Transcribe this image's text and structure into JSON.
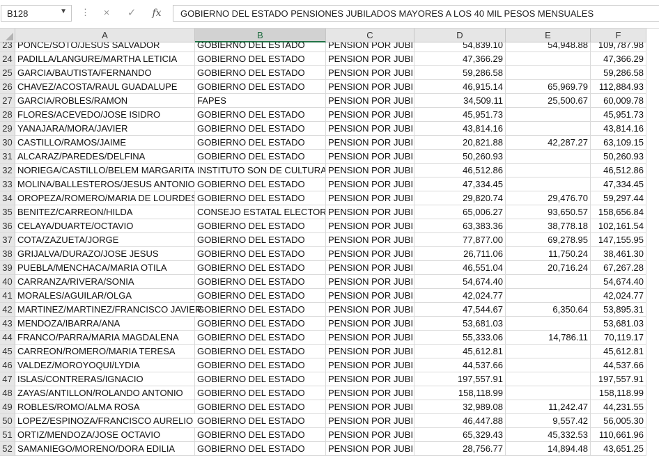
{
  "formula_bar": {
    "name_box": "B128",
    "cancel_icon": "×",
    "enter_icon": "✓",
    "fx_label": "fx",
    "formula": "GOBIERNO DEL ESTADO PENSIONES JUBILADOS MAYORES A LOS 40 MIL PESOS MENSUALES"
  },
  "columns": [
    "A",
    "B",
    "C",
    "D",
    "E",
    "F"
  ],
  "selected_column": "B",
  "rows": [
    {
      "n": "23",
      "a": "PONCE/SOTO/JESUS SALVADOR",
      "b": "GOBIERNO DEL ESTADO",
      "c": "PENSION POR JUBILACION",
      "d": "54,839.10",
      "e": "54,948.88",
      "f": "109,787.98"
    },
    {
      "n": "24",
      "a": "PADILLA/LANGURE/MARTHA LETICIA",
      "b": "GOBIERNO DEL ESTADO",
      "c": "PENSION POR JUBILACION",
      "d": "47,366.29",
      "e": "",
      "f": "47,366.29"
    },
    {
      "n": "25",
      "a": "GARCIA/BAUTISTA/FERNANDO",
      "b": "GOBIERNO DEL ESTADO",
      "c": "PENSION POR JUBILACION",
      "d": "59,286.58",
      "e": "",
      "f": "59,286.58"
    },
    {
      "n": "26",
      "a": "CHAVEZ/ACOSTA/RAUL GUADALUPE",
      "b": "GOBIERNO DEL ESTADO",
      "c": "PENSION POR JUBILACION",
      "d": "46,915.14",
      "e": "65,969.79",
      "f": "112,884.93"
    },
    {
      "n": "27",
      "a": "GARCIA/ROBLES/RAMON",
      "b": "FAPES",
      "c": "PENSION POR JUBILACION",
      "d": "34,509.11",
      "e": "25,500.67",
      "f": "60,009.78"
    },
    {
      "n": "28",
      "a": "FLORES/ACEVEDO/JOSE ISIDRO",
      "b": "GOBIERNO DEL ESTADO",
      "c": "PENSION POR JUBILACION",
      "d": "45,951.73",
      "e": "",
      "f": "45,951.73"
    },
    {
      "n": "29",
      "a": "YANAJARA/MORA/JAVIER",
      "b": "GOBIERNO DEL ESTADO",
      "c": "PENSION POR JUBILACION",
      "d": "43,814.16",
      "e": "",
      "f": "43,814.16"
    },
    {
      "n": "30",
      "a": "CASTILLO/RAMOS/JAIME",
      "b": "GOBIERNO DEL ESTADO",
      "c": "PENSION POR JUBILACION",
      "d": "20,821.88",
      "e": "42,287.27",
      "f": "63,109.15"
    },
    {
      "n": "31",
      "a": "ALCARAZ/PAREDES/DELFINA",
      "b": "GOBIERNO DEL ESTADO",
      "c": "PENSION POR JUBILACION",
      "d": "50,260.93",
      "e": "",
      "f": "50,260.93"
    },
    {
      "n": "32",
      "a": "NORIEGA/CASTILLO/BELEM MARGARITA",
      "b": "INSTITUTO SON DE CULTURA",
      "c": "PENSION POR JUBILACION",
      "d": "46,512.86",
      "e": "",
      "f": "46,512.86"
    },
    {
      "n": "33",
      "a": "MOLINA/BALLESTEROS/JESUS ANTONIO",
      "b": "GOBIERNO DEL ESTADO",
      "c": "PENSION POR JUBILACION",
      "d": "47,334.45",
      "e": "",
      "f": "47,334.45"
    },
    {
      "n": "34",
      "a": "OROPEZA/ROMERO/MARIA DE LOURDES",
      "b": "GOBIERNO DEL ESTADO",
      "c": "PENSION POR JUBILACION",
      "d": "29,820.74",
      "e": "29,476.70",
      "f": "59,297.44"
    },
    {
      "n": "35",
      "a": "BENITEZ/CARREON/HILDA",
      "b": "CONSEJO ESTATAL ELECTORAL",
      "c": "PENSION POR JUBILACION",
      "d": "65,006.27",
      "e": "93,650.57",
      "f": "158,656.84"
    },
    {
      "n": "36",
      "a": "CELAYA/DUARTE/OCTAVIO",
      "b": "GOBIERNO DEL ESTADO",
      "c": "PENSION POR JUBILACION",
      "d": "63,383.36",
      "e": "38,778.18",
      "f": "102,161.54"
    },
    {
      "n": "37",
      "a": "COTA/ZAZUETA/JORGE",
      "b": "GOBIERNO DEL ESTADO",
      "c": "PENSION POR JUBILACION",
      "d": "77,877.00",
      "e": "69,278.95",
      "f": "147,155.95"
    },
    {
      "n": "38",
      "a": "GRIJALVA/DURAZO/JOSE JESUS",
      "b": "GOBIERNO DEL ESTADO",
      "c": "PENSION POR JUBILACION",
      "d": "26,711.06",
      "e": "11,750.24",
      "f": "38,461.30"
    },
    {
      "n": "39",
      "a": "PUEBLA/MENCHACA/MARIA OTILA",
      "b": "GOBIERNO DEL ESTADO",
      "c": "PENSION POR JUBILACION",
      "d": "46,551.04",
      "e": "20,716.24",
      "f": "67,267.28"
    },
    {
      "n": "40",
      "a": "CARRANZA/RIVERA/SONIA",
      "b": "GOBIERNO DEL ESTADO",
      "c": "PENSION POR JUBILACION",
      "d": "54,674.40",
      "e": "",
      "f": "54,674.40"
    },
    {
      "n": "41",
      "a": "MORALES/AGUILAR/OLGA",
      "b": "GOBIERNO DEL ESTADO",
      "c": "PENSION POR JUBILACION",
      "d": "42,024.77",
      "e": "",
      "f": "42,024.77"
    },
    {
      "n": "42",
      "a": "MARTINEZ/MARTINEZ/FRANCISCO JAVIER",
      "b": "GOBIERNO DEL ESTADO",
      "c": "PENSION POR JUBILACION",
      "d": "47,544.67",
      "e": "6,350.64",
      "f": "53,895.31"
    },
    {
      "n": "43",
      "a": "MENDOZA/IBARRA/ANA",
      "b": "GOBIERNO DEL ESTADO",
      "c": "PENSION POR JUBILACION",
      "d": "53,681.03",
      "e": "",
      "f": "53,681.03"
    },
    {
      "n": "44",
      "a": "FRANCO/PARRA/MARIA MAGDALENA",
      "b": "GOBIERNO DEL ESTADO",
      "c": "PENSION POR JUBILACION",
      "d": "55,333.06",
      "e": "14,786.11",
      "f": "70,119.17"
    },
    {
      "n": "45",
      "a": "CARREON/ROMERO/MARIA TERESA",
      "b": "GOBIERNO DEL ESTADO",
      "c": "PENSION POR JUBILACION",
      "d": "45,612.81",
      "e": "",
      "f": "45,612.81"
    },
    {
      "n": "46",
      "a": "VALDEZ/MOROYOQUI/LYDIA",
      "b": "GOBIERNO DEL ESTADO",
      "c": "PENSION POR JUBILACION",
      "d": "44,537.66",
      "e": "",
      "f": "44,537.66"
    },
    {
      "n": "47",
      "a": "ISLAS/CONTRERAS/IGNACIO",
      "b": "GOBIERNO DEL ESTADO",
      "c": "PENSION POR JUBILACION",
      "d": "197,557.91",
      "e": "",
      "f": "197,557.91"
    },
    {
      "n": "48",
      "a": "ZAYAS/ANTILLON/ROLANDO ANTONIO",
      "b": "GOBIERNO DEL ESTADO",
      "c": "PENSION POR JUBILACION",
      "d": "158,118.99",
      "e": "",
      "f": "158,118.99"
    },
    {
      "n": "49",
      "a": "ROBLES/ROMO/ALMA ROSA",
      "b": "GOBIERNO DEL ESTADO",
      "c": "PENSION POR JUBILACION",
      "d": "32,989.08",
      "e": "11,242.47",
      "f": "44,231.55"
    },
    {
      "n": "50",
      "a": "LOPEZ/ESPINOZA/FRANCISCO AURELIO",
      "b": "GOBIERNO DEL ESTADO",
      "c": "PENSION POR JUBILACION",
      "d": "46,447.88",
      "e": "9,557.42",
      "f": "56,005.30"
    },
    {
      "n": "51",
      "a": "ORTIZ/MENDOZA/JOSE OCTAVIO",
      "b": "GOBIERNO DEL ESTADO",
      "c": "PENSION POR JUBILACION",
      "d": "65,329.43",
      "e": "45,332.53",
      "f": "110,661.96"
    },
    {
      "n": "52",
      "a": "SAMANIEGO/MORENO/DORA EDILIA",
      "b": "GOBIERNO DEL ESTADO",
      "c": "PENSION POR JUBILACION",
      "d": "28,756.77",
      "e": "14,894.48",
      "f": "43,651.25"
    }
  ]
}
